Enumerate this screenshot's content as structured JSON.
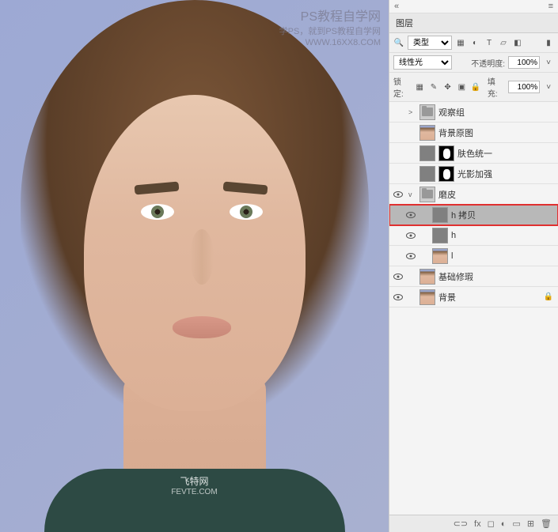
{
  "watermark1": {
    "line1": "PS教程自学网",
    "line2": "学PS，就到PS教程自学网",
    "line3": "WWW.16XX8.COM"
  },
  "watermark2": {
    "line1": "飞特网",
    "line2": "FEVTE.COM"
  },
  "panel": {
    "title": "图层",
    "kind_filter": "类型",
    "blend_mode": "线性光",
    "opacity_label": "不透明度:",
    "opacity_val": "100%",
    "lock_label": "锁定:",
    "fill_label": "填充:",
    "fill_val": "100%"
  },
  "layers": [
    {
      "vis": false,
      "tw": ">",
      "type": "folder",
      "name": "观察组",
      "ind": 0
    },
    {
      "vis": false,
      "tw": "",
      "type": "face",
      "name": "背景原图",
      "ind": 0
    },
    {
      "vis": false,
      "tw": "",
      "type": "mask",
      "name": "肤色统一",
      "ind": 0
    },
    {
      "vis": false,
      "tw": "",
      "type": "mask",
      "name": "光影加强",
      "ind": 0
    },
    {
      "vis": true,
      "tw": "v",
      "type": "folder",
      "name": "磨皮",
      "ind": 0
    },
    {
      "vis": true,
      "tw": "",
      "type": "gray",
      "name": "h 拷贝",
      "ind": 1,
      "hl": true
    },
    {
      "vis": true,
      "tw": "",
      "type": "gray",
      "name": "h",
      "ind": 1
    },
    {
      "vis": true,
      "tw": "",
      "type": "face",
      "name": "l",
      "ind": 1
    },
    {
      "vis": true,
      "tw": "",
      "type": "face",
      "name": "基础修瑕",
      "ind": 0
    },
    {
      "vis": true,
      "tw": "",
      "type": "face",
      "name": "背景",
      "ind": 0,
      "lock": true
    }
  ],
  "bottom": {
    "link": "⊂⊃",
    "fx": "fx",
    "mask": "◻",
    "adj": "◐",
    "group": "▭",
    "new": "⊞",
    "del": "🗑"
  }
}
